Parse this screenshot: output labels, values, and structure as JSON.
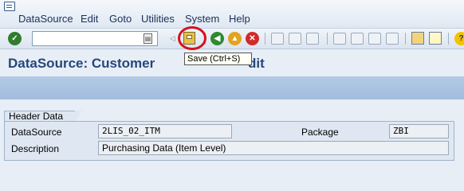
{
  "menu": {
    "items": [
      "DataSource",
      "Edit",
      "Goto",
      "Utilities",
      "System",
      "Help"
    ]
  },
  "toolbar": {
    "command_value": "",
    "icons": [
      "enter-icon",
      "command-dropdown-icon",
      "collapse-icon",
      "save-icon",
      "back-icon",
      "exit-icon",
      "cancel-icon",
      "print-icon",
      "find-icon",
      "find-next-icon",
      "first-page-icon",
      "previous-page-icon",
      "next-page-icon",
      "last-page-icon",
      "create-session-icon",
      "shortcut-icon",
      "help-icon"
    ]
  },
  "page": {
    "title_start": "DataSource: Customer ",
    "title_end": "dit"
  },
  "tooltip": {
    "text": "Save  (Ctrl+S)"
  },
  "header_data": {
    "group_title": "Header Data",
    "datasource_label": "DataSource",
    "datasource_value": "2LIS_02_ITM",
    "package_label": "Package",
    "package_value": "ZBI",
    "description_label": "Description",
    "description_value": "Purchasing Data (Item Level)"
  },
  "colors": {
    "title": "#25477a",
    "highlight": "#d4121c",
    "appbar": "#a9c2e0"
  }
}
